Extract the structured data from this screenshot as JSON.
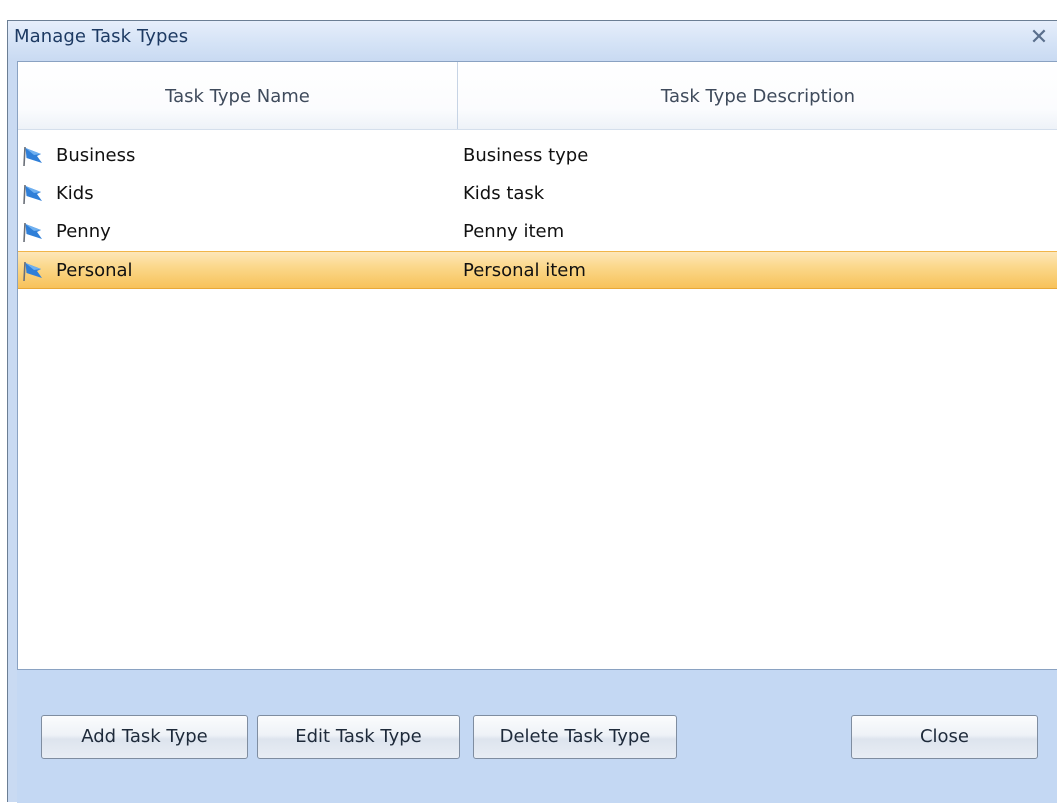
{
  "window": {
    "title": "Manage Task Types",
    "close_glyph": "✕"
  },
  "list": {
    "columns": [
      "Task Type Name",
      "Task Type Description"
    ],
    "rows": [
      {
        "name": "Business",
        "description": "Business type",
        "icon": "flag-icon",
        "selected": false
      },
      {
        "name": "Kids",
        "description": "Kids task",
        "icon": "flag-icon",
        "selected": false
      },
      {
        "name": "Penny",
        "description": "Penny item",
        "icon": "flag-icon",
        "selected": false
      },
      {
        "name": "Personal",
        "description": "Personal item",
        "icon": "flag-icon",
        "selected": true
      }
    ]
  },
  "buttons": {
    "add": "Add Task Type",
    "edit": "Edit Task Type",
    "delete": "Delete Task Type",
    "close": "Close"
  },
  "colors": {
    "flag": "#2f7fd8",
    "selection": "#f7c25a",
    "footer": "#c4d8f3"
  }
}
